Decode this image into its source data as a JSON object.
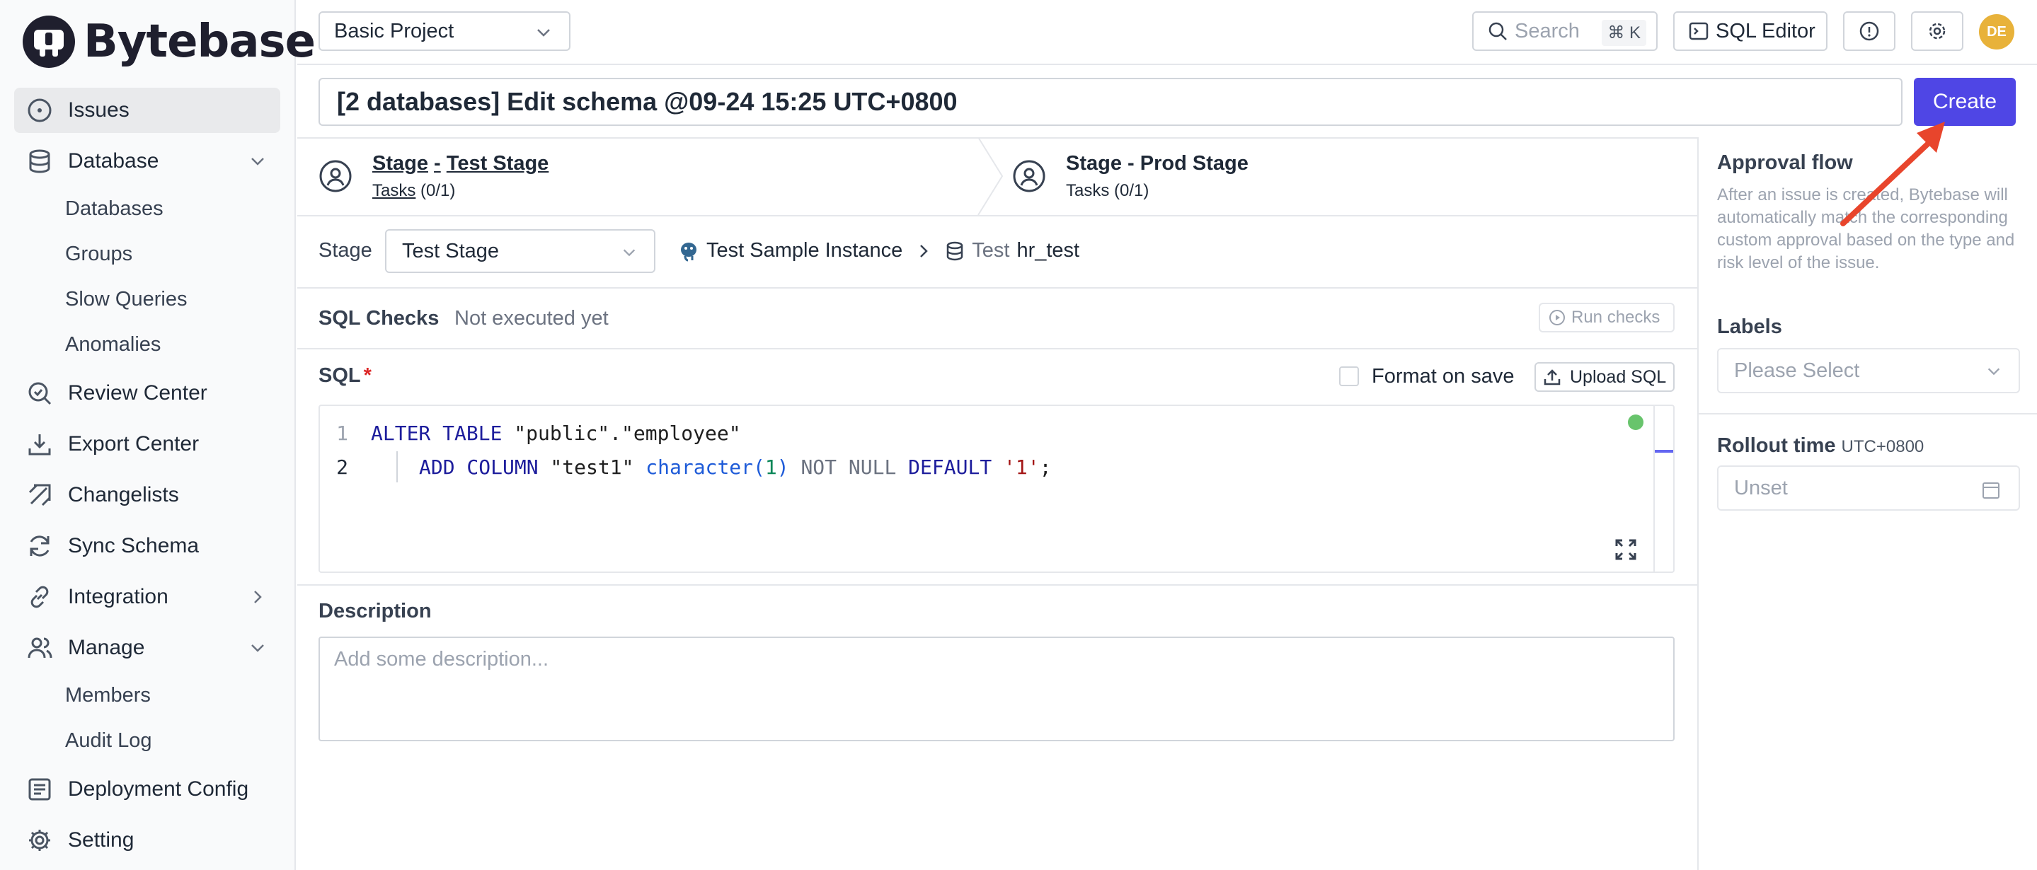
{
  "app": {
    "name": "Bytebase"
  },
  "sidebar": {
    "items": [
      {
        "label": "Issues",
        "icon": "issues-icon"
      },
      {
        "label": "Database",
        "icon": "database-icon"
      },
      {
        "label": "Review Center",
        "icon": "review-center-icon"
      },
      {
        "label": "Export Center",
        "icon": "export-center-icon"
      },
      {
        "label": "Changelists",
        "icon": "changelists-icon"
      },
      {
        "label": "Sync Schema",
        "icon": "sync-schema-icon"
      },
      {
        "label": "Integration",
        "icon": "integration-icon"
      },
      {
        "label": "Manage",
        "icon": "manage-icon"
      },
      {
        "label": "Deployment Config",
        "icon": "deployment-config-icon"
      },
      {
        "label": "Setting",
        "icon": "setting-icon"
      }
    ],
    "database_sub": [
      "Databases",
      "Groups",
      "Slow Queries",
      "Anomalies"
    ],
    "manage_sub": [
      "Members",
      "Audit Log"
    ]
  },
  "topbar": {
    "project": "Basic Project",
    "search_placeholder": "Search",
    "search_shortcut": "⌘ K",
    "sql_editor_label": "SQL Editor",
    "avatar_initials": "DE"
  },
  "issue": {
    "title": "[2 databases] Edit schema @09-24 15:25 UTC+0800",
    "create_label": "Create"
  },
  "stages": [
    {
      "prefix": "Stage",
      "sep": "-",
      "name": "Test Stage",
      "tasks_label": "Tasks",
      "tasks_count": "(0/1)"
    },
    {
      "title": "Stage - Prod Stage",
      "tasks_label": "Tasks",
      "tasks_count": "(0/1)"
    }
  ],
  "stage_selector": {
    "label": "Stage",
    "value": "Test Stage",
    "instance": "Test Sample Instance",
    "env": "Test",
    "database": "hr_test"
  },
  "sql_checks": {
    "label": "SQL Checks",
    "status": "Not executed yet",
    "run_label": "Run checks"
  },
  "sql": {
    "label": "SQL",
    "required_mark": "*",
    "format_on_save_label": "Format on save",
    "upload_label": "Upload SQL",
    "line_numbers": [
      "1",
      "2"
    ],
    "line1": {
      "kw1": "ALTER TABLE",
      "t1": " \"public\".\"employee\""
    },
    "line2": {
      "kw1": "ADD COLUMN",
      "t1": " \"test1\" ",
      "ty": "character",
      "p1": "(",
      "num": "1",
      "p2": ")",
      "g1": " NOT NULL ",
      "kw2": "DEFAULT",
      "sp": " ",
      "str": "'1'",
      "end": ";"
    }
  },
  "description": {
    "label": "Description",
    "placeholder": "Add some description..."
  },
  "right_panel": {
    "approval_title": "Approval flow",
    "approval_desc": "After an issue is created, Bytebase will automatically match the corresponding custom approval based on the type and risk level of the issue.",
    "labels_title": "Labels",
    "labels_placeholder": "Please Select",
    "rollout_title": "Rollout time",
    "rollout_tz": "UTC+0800",
    "rollout_placeholder": "Unset"
  },
  "colors": {
    "primary": "#4f46e5",
    "arrow": "#e8452c",
    "avatar": "#e8b23a",
    "status_ok": "#68c46c"
  }
}
